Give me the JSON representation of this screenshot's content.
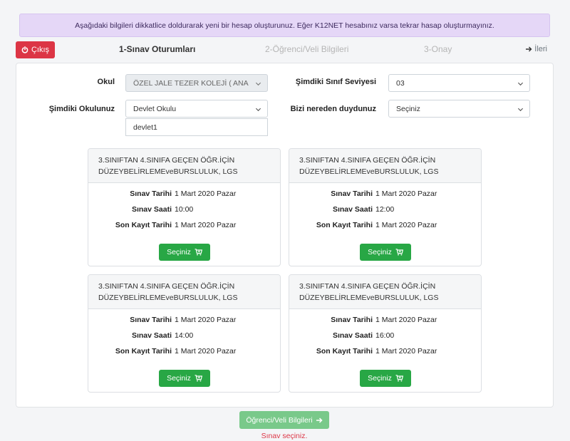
{
  "alert_text": "Aşağıdaki bilgileri dikkatlice doldurarak yeni bir hesap oluşturunuz. Eğer K12NET hesabınız varsa tekrar hasap oluşturmayınız.",
  "logout_label": "Çıkış",
  "steps": [
    "1-Sınav Oturumları",
    "2-Öğrenci/Veli Bilgileri",
    "3-Onay"
  ],
  "next_label": "İleri",
  "form": {
    "school_label": "Okul",
    "school_value": "ÖZEL JALE TEZER KOLEJİ ( ANA",
    "grade_label": "Şimdiki Sınıf Seviyesi",
    "grade_value": "03",
    "current_school_label": "Şimdiki Okulunuz",
    "current_school_value": "Devlet Okulu",
    "current_school_name": "devlet1",
    "source_label": "Bizi nereden duydunuz",
    "source_value": "Seçiniz"
  },
  "card_labels": {
    "date": "Sınav Tarihi",
    "time": "Sınav Saati",
    "deadline": "Son Kayıt Tarihi",
    "button": "Seçiniz"
  },
  "sessions": [
    {
      "title": "3.SINIFTAN 4.SINIFA GEÇEN ÖĞR.İÇİN DÜZEYBELİRLEMEveBURSLULUK, LGS",
      "date": "1 Mart 2020 Pazar",
      "time": "10:00",
      "deadline": "1 Mart 2020 Pazar"
    },
    {
      "title": "3.SINIFTAN 4.SINIFA GEÇEN ÖĞR.İÇİN DÜZEYBELİRLEMEveBURSLULUK, LGS",
      "date": "1 Mart 2020 Pazar",
      "time": "12:00",
      "deadline": "1 Mart 2020 Pazar"
    },
    {
      "title": "3.SINIFTAN 4.SINIFA GEÇEN ÖĞR.İÇİN DÜZEYBELİRLEMEveBURSLULUK, LGS",
      "date": "1 Mart 2020 Pazar",
      "time": "14:00",
      "deadline": "1 Mart 2020 Pazar"
    },
    {
      "title": "3.SINIFTAN 4.SINIFA GEÇEN ÖĞR.İÇİN DÜZEYBELİRLEMEveBURSLULUK, LGS",
      "date": "1 Mart 2020 Pazar",
      "time": "16:00",
      "deadline": "1 Mart 2020 Pazar"
    }
  ],
  "submit_label": "Öğrenci/Veli Bilgileri",
  "error_text": "Sınav seçiniz.",
  "colors": {
    "danger": "#dc3545",
    "success": "#28a745",
    "alert_bg": "#e5d7f7"
  }
}
